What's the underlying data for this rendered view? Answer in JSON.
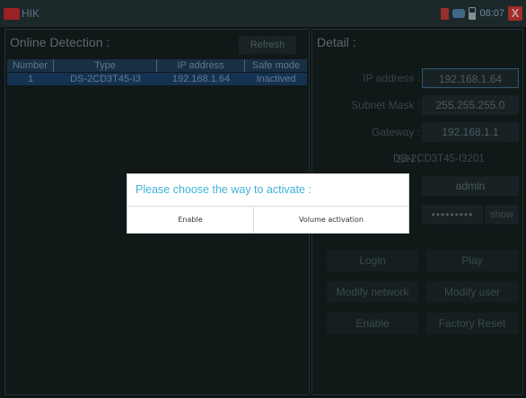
{
  "statusbar": {
    "logo_text": "HIK",
    "clock": "08:07",
    "close_glyph": "X",
    "icons": [
      "sd-card-icon",
      "usb-icon",
      "battery-icon",
      "close-icon"
    ]
  },
  "online": {
    "title": "Online Detection :",
    "refresh_label": "Refresh",
    "columns": [
      "Number",
      "Type",
      "IP address",
      "Safe mode"
    ],
    "rows": [
      [
        "1",
        "DS-2CD3T45-I3",
        "192.168.1.64",
        "Inactived"
      ]
    ]
  },
  "detail": {
    "title": "Detail :",
    "ip_label": "IP address :",
    "ip_value": "192.168.1.64",
    "mask_label": "Subnet Mask :",
    "mask_value": "255.255.255.0",
    "gateway_label": "Gateway :",
    "gateway_value": "192.168.1.1",
    "sn_label": "S/N :",
    "sn_value": "DS-2CD3T45-I3201",
    "user_value": "admin",
    "password_value": "•••••••••",
    "show_label": "show",
    "buttons": {
      "login": "Login",
      "play": "Play",
      "modify_network": "Modify network",
      "modify_user": "Modify user",
      "enable": "Enable",
      "factory_reset": "Factory Reset"
    }
  },
  "dialog": {
    "title": "Please choose the way to activate :",
    "enable_label": "Enable",
    "volume_label": "Volume activation"
  },
  "colors": {
    "background": "#121a1a",
    "table_header": "#1e3b53",
    "selected_row": "#1a3d64",
    "dialog_title": "#3fb3d9",
    "close_red": "#c7362f"
  }
}
